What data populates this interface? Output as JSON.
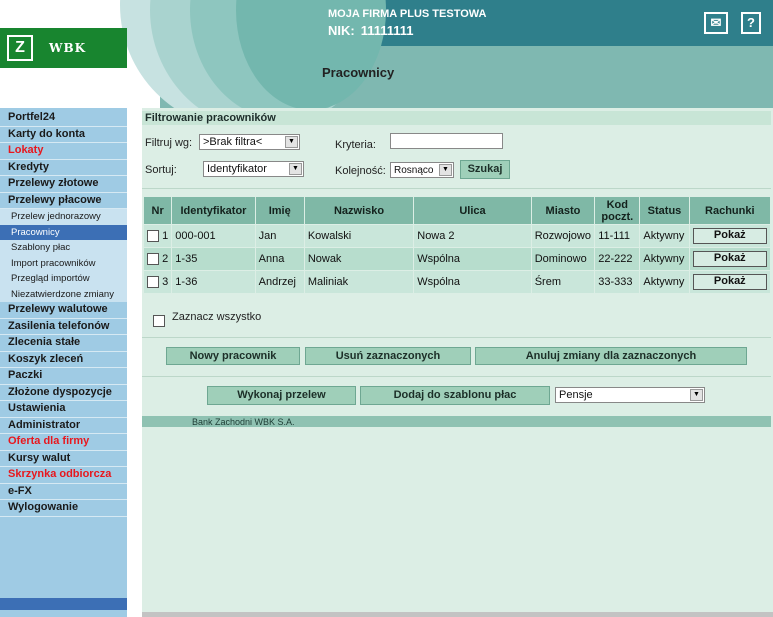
{
  "header": {
    "company": "MOJA FIRMA PLUS TESTOWA",
    "nik_label": "NIK:",
    "nik_value": "11111111",
    "page_title": "Pracownicy",
    "logo_text": "WBK",
    "logo_mark": "Z",
    "mail_icon": "mail-icon",
    "help_icon": "help-icon",
    "help_glyph": "?",
    "mail_glyph": "✉"
  },
  "sidebar": {
    "items": [
      {
        "label": "Portfel24",
        "type": "item"
      },
      {
        "label": "Karty do konta",
        "type": "item"
      },
      {
        "label": "Lokaty",
        "type": "item",
        "color": "#e8171d"
      },
      {
        "label": "Kredyty",
        "type": "item"
      },
      {
        "label": "Przelewy złotowe",
        "type": "item"
      },
      {
        "label": "Przelewy płacowe",
        "type": "item"
      },
      {
        "label": "Przelew jednorazowy",
        "type": "sub"
      },
      {
        "label": "Pracownicy",
        "type": "sub",
        "active": true
      },
      {
        "label": "Szablony płac",
        "type": "sub"
      },
      {
        "label": "Import pracowników",
        "type": "sub"
      },
      {
        "label": "Przegląd importów",
        "type": "sub"
      },
      {
        "label": "Niezatwierdzone zmiany",
        "type": "sub"
      },
      {
        "label": "Przelewy walutowe",
        "type": "item"
      },
      {
        "label": "Zasilenia telefonów",
        "type": "item"
      },
      {
        "label": "Zlecenia stałe",
        "type": "item"
      },
      {
        "label": "Koszyk zleceń",
        "type": "item"
      },
      {
        "label": "Paczki",
        "type": "item"
      },
      {
        "label": "Złożone dyspozycje",
        "type": "item"
      },
      {
        "label": "Ustawienia",
        "type": "item"
      },
      {
        "label": "Administrator",
        "type": "item"
      },
      {
        "label": "Oferta dla firmy",
        "type": "item",
        "color": "#e8171d"
      },
      {
        "label": "Kursy walut",
        "type": "item"
      },
      {
        "label": "Skrzynka odbiorcza",
        "type": "item",
        "color": "#e8171d"
      },
      {
        "label": "e-FX",
        "type": "item"
      },
      {
        "label": "Wylogowanie",
        "type": "item"
      }
    ]
  },
  "filter": {
    "title": "Filtrowanie pracowników",
    "filter_by_label": "Filtruj wg:",
    "filter_by_value": ">Brak filtra<",
    "criteria_label": "Kryteria:",
    "criteria_value": "",
    "sort_label": "Sortuj:",
    "sort_value": "Identyfikator",
    "order_label": "Kolejność:",
    "order_value": "Rosnąco",
    "search_button": "Szukaj"
  },
  "table": {
    "headers": [
      "Nr",
      "Identyfikator",
      "Imię",
      "Nazwisko",
      "Ulica",
      "Miasto",
      "Kod poczt.",
      "Status",
      "Rachunki"
    ],
    "rows": [
      {
        "nr": "1",
        "id": "000-001",
        "first": "Jan",
        "last": "Kowalski",
        "street": "Nowa 2",
        "city": "Rozwojowo",
        "zip": "11-111",
        "status": "Aktywny",
        "action": "Pokaż"
      },
      {
        "nr": "2",
        "id": "1-35",
        "first": "Anna",
        "last": "Nowak",
        "street": "Wspólna",
        "city": "Dominowo",
        "zip": "22-222",
        "status": "Aktywny",
        "action": "Pokaż"
      },
      {
        "nr": "3",
        "id": "1-36",
        "first": "Andrzej",
        "last": "Maliniak",
        "street": "Wspólna",
        "city": "Śrem",
        "zip": "33-333",
        "status": "Aktywny",
        "action": "Pokaż"
      }
    ]
  },
  "select_all_label": "Zaznacz wszystko",
  "actions": {
    "new_employee": "Nowy pracownik",
    "delete_selected": "Usuń zaznaczonych",
    "cancel_changes": "Anuluj zmiany dla zaznaczonych",
    "make_transfer": "Wykonaj przelew",
    "add_to_template": "Dodaj do szablonu płac",
    "template_value": "Pensje"
  },
  "footer": {
    "text": "Bank Zachodni WBK S.A."
  }
}
